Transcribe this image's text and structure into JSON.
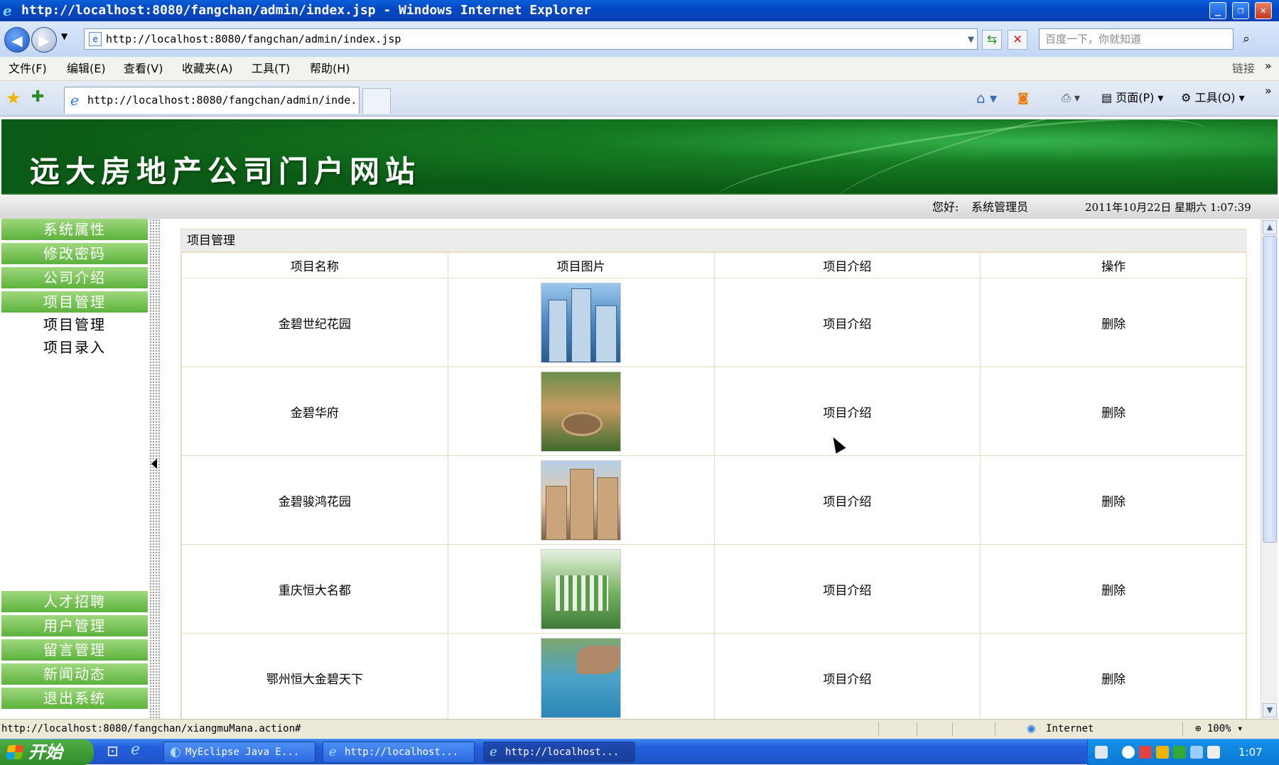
{
  "window": {
    "title": "http://localhost:8080/fangchan/admin/index.jsp - Windows Internet Explorer",
    "address": "http://localhost:8080/fangchan/admin/index.jsp",
    "search_placeholder": "百度一下，你就知道",
    "links_label": "链接"
  },
  "menu": [
    "文件(F)",
    "编辑(E)",
    "查看(V)",
    "收藏夹(A)",
    "工具(T)",
    "帮助(H)"
  ],
  "tab": {
    "label": "http://localhost:8080/fangchan/admin/inde...",
    "page_menu": "页面(P)",
    "tools_menu": "工具(O)"
  },
  "site": {
    "banner_title": "远大房地产公司门户网站",
    "greeting_label": "您好:",
    "user": "系统管理员",
    "datetime": "2011年10月22日  星期六  1:07:39"
  },
  "sidebar": {
    "top_buttons": [
      "系统属性",
      "修改密码",
      "公司介绍",
      "项目管理"
    ],
    "sub_links": [
      "项目管理",
      "项目录入"
    ],
    "bottom_buttons": [
      "人才招聘",
      "用户管理",
      "留言管理",
      "新闻动态",
      "退出系统"
    ]
  },
  "panel": {
    "title": "项目管理",
    "columns": [
      "项目名称",
      "项目图片",
      "项目介绍",
      "操作"
    ],
    "rows": [
      {
        "name": "金碧世纪花园",
        "intro": "项目介绍",
        "action": "删除",
        "image": "highrise-towers"
      },
      {
        "name": "金碧华府",
        "intro": "项目介绍",
        "action": "删除",
        "image": "garden-fountain"
      },
      {
        "name": "金碧骏鸿花园",
        "intro": "项目介绍",
        "action": "删除",
        "image": "apartment-blocks"
      },
      {
        "name": "重庆恒大名都",
        "intro": "项目介绍",
        "action": "删除",
        "image": "aerial-green-estate"
      },
      {
        "name": "鄂州恒大金碧天下",
        "intro": "项目介绍",
        "action": "删除",
        "image": "lakeside-aerial"
      }
    ]
  },
  "status": {
    "url": "http://localhost:8080/fangchan/xiangmuMana.action#",
    "zone": "Internet",
    "zoom": "100%"
  },
  "taskbar": {
    "start": "开始",
    "tasks": [
      "MyEclipse Java E...",
      "http://localhost...",
      "http://localhost..."
    ],
    "clock": "1:07"
  },
  "colors": {
    "title_blue": "#0449c4",
    "banner_green": "#157a22",
    "sidebar_green": "#5cb23c",
    "taskbar_blue": "#245edb"
  }
}
